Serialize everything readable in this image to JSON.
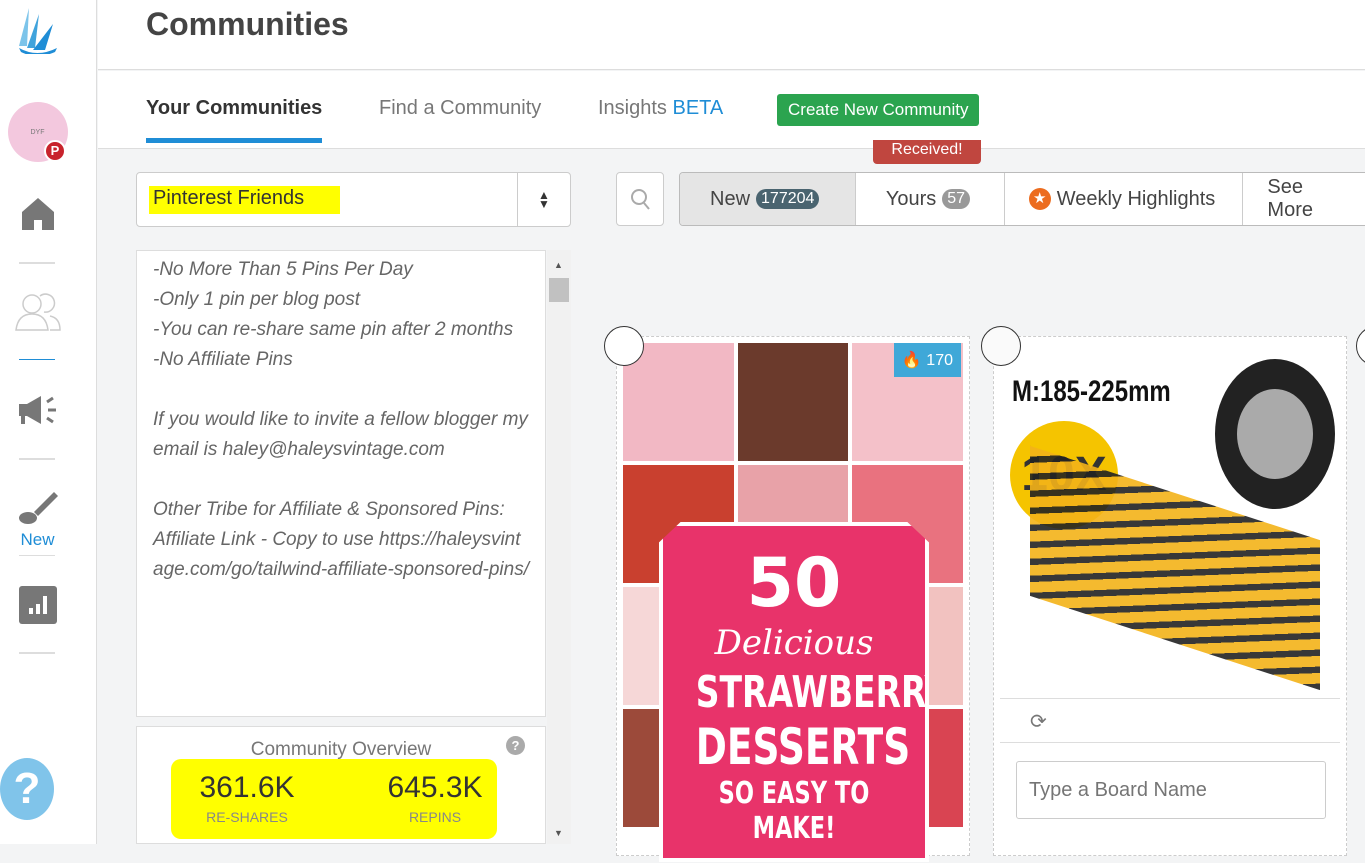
{
  "sidebar": {
    "avatar_text": "DYF",
    "new_label": "New",
    "icons": [
      "tailwind-logo",
      "home-icon",
      "users-icon",
      "megaphone-icon",
      "brush-icon",
      "chart-icon",
      "help-icon"
    ]
  },
  "header": {
    "title": "Communities"
  },
  "tabs": {
    "your": "Your Communities",
    "find": "Find a Community",
    "insights": "Insights",
    "beta": "BETA",
    "create": "Create New Community"
  },
  "community_select": {
    "value": "Pinterest Friends"
  },
  "filters": {
    "new_label": "New",
    "new_count": "177204",
    "yours_label": "Yours",
    "yours_count": "57",
    "weekly": "Weekly Highlights",
    "more": "See More",
    "tooltip": "Received!"
  },
  "rules": [
    "-No More Than 5 Pins Per Day",
    "-Only 1 pin per blog post",
    "-You can re-share same pin after 2 months",
    "-No Affiliate Pins",
    "",
    "If you would like to invite a fellow blogger my email is haley@haleysvintage.com",
    "",
    "Other Tribe for Affiliate & Sponsored Pins:",
    "Affiliate Link - Copy to use https://haleysvintage.com/go/tailwind-affiliate-sponsored-pins/"
  ],
  "overview": {
    "title": "Community Overview",
    "reshares": "361.6K",
    "reshares_label": "RE-SHARES",
    "repins": "645.3K",
    "repins_label": "REPINS"
  },
  "pins": [
    {
      "count": "170",
      "line1": "50",
      "line2": "Delicious",
      "line3": "STRAWBERRY",
      "line4": "DESSERTS",
      "line5": "SO EASY TO MAKE!"
    },
    {
      "size_text": "M:185-225mm",
      "qty": "10X",
      "board_placeholder": "Type a Board Name"
    }
  ],
  "colors": {
    "accent": "#1f8dd6",
    "create": "#2ba44f",
    "tooltip": "#c0463f",
    "highlight": "#ffff00",
    "pink": "#e8336a"
  }
}
